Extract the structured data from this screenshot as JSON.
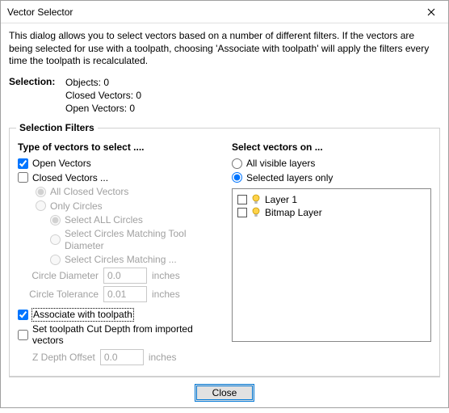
{
  "window": {
    "title": "Vector Selector"
  },
  "intro": "This dialog allows you to select vectors based on a number of different filters. If the vectors are being selected for use with a toolpath, choosing 'Associate with toolpath' will apply the filters every time the toolpath is recalculated.",
  "selection": {
    "label": "Selection:",
    "objects": "Objects: 0",
    "closed": "Closed Vectors: 0",
    "open": "Open Vectors: 0"
  },
  "filters": {
    "legend": "Selection Filters",
    "type_head": "Type of vectors to select ....",
    "open_vectors": "Open Vectors",
    "closed_vectors": "Closed Vectors ...",
    "all_closed": "All Closed Vectors",
    "only_circles": "Only Circles",
    "select_all_circles": "Select ALL Circles",
    "select_match_tool": "Select Circles Matching Tool Diameter",
    "select_match": "Select Circles Matching ...",
    "circle_diameter_lbl": "Circle Diameter",
    "circle_diameter_val": "0.0",
    "circle_tol_lbl": "Circle Tolerance",
    "circle_tol_val": "0.01",
    "units": "inches",
    "associate": "Associate with toolpath",
    "set_cut_depth": "Set toolpath Cut Depth from imported vectors",
    "z_offset_lbl": "Z Depth Offset",
    "z_offset_val": "0.0"
  },
  "layers_panel": {
    "head": "Select vectors on ...",
    "all_visible": "All visible layers",
    "selected_only": "Selected layers only",
    "layers": [
      "Layer 1",
      "Bitmap Layer"
    ]
  },
  "footer": {
    "close": "Close"
  }
}
